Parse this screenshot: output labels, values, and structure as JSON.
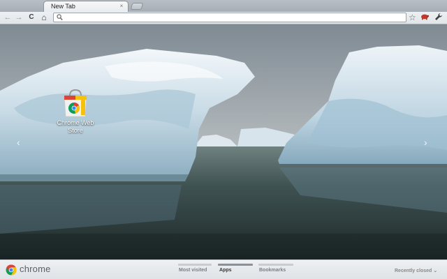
{
  "tab": {
    "title": "New Tab",
    "close_glyph": "×"
  },
  "toolbar": {
    "back_glyph": "←",
    "forward_glyph": "→",
    "reload_glyph": "C",
    "home_glyph": "⌂",
    "omnibox_value": "",
    "star_glyph": "☆",
    "wrench_glyph": "🔧"
  },
  "apps": [
    {
      "label": "Chrome Web Store",
      "icon": "web-store-icon"
    }
  ],
  "pager": {
    "left_glyph": "‹",
    "right_glyph": "›"
  },
  "footer": {
    "logo_text": "chrome",
    "sections": [
      "Most visited",
      "Apps",
      "Bookmarks"
    ],
    "active_section": "Apps",
    "recently_closed": "Recently closed ⌄"
  },
  "colors": {
    "chrome_red": "#db4437",
    "chrome_yellow": "#f4c20d",
    "chrome_green": "#0f9d58",
    "chrome_blue": "#4285f4"
  }
}
